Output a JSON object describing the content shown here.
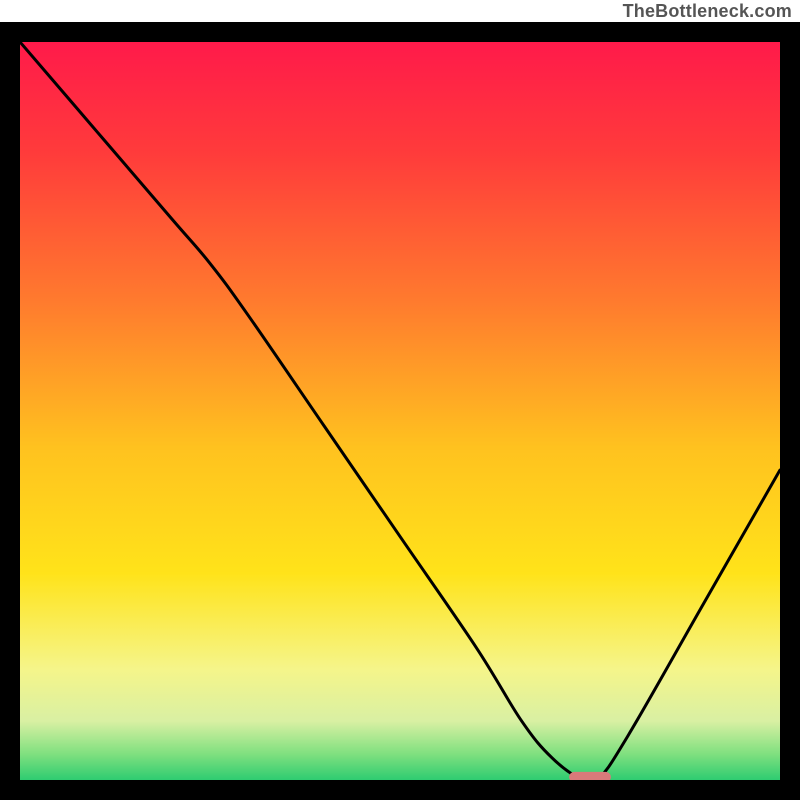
{
  "watermark": "TheBottleneck.com",
  "chart_data": {
    "type": "line",
    "title": "",
    "xlabel": "",
    "ylabel": "",
    "xlim": [
      0,
      100
    ],
    "ylim": [
      0,
      100
    ],
    "series": [
      {
        "name": "bottleneck-curve",
        "x": [
          0,
          10,
          20,
          25,
          30,
          40,
          50,
          60,
          66,
          70,
          74,
          76,
          80,
          90,
          100
        ],
        "y": [
          100,
          88,
          76,
          70,
          63,
          48,
          33,
          18,
          8,
          3,
          0,
          0,
          6,
          24,
          42
        ]
      }
    ],
    "marker": {
      "x": 75,
      "y": 0,
      "width": 5.5,
      "height": 1.4,
      "color": "#d97a7a"
    },
    "gradient_stops": [
      {
        "offset": 0.0,
        "color": "#ff1a4a"
      },
      {
        "offset": 0.15,
        "color": "#ff3b3b"
      },
      {
        "offset": 0.35,
        "color": "#ff7a2e"
      },
      {
        "offset": 0.55,
        "color": "#ffc21f"
      },
      {
        "offset": 0.72,
        "color": "#ffe31a"
      },
      {
        "offset": 0.85,
        "color": "#f5f58a"
      },
      {
        "offset": 0.92,
        "color": "#d9f0a3"
      },
      {
        "offset": 0.965,
        "color": "#7fe07f"
      },
      {
        "offset": 1.0,
        "color": "#2ecc71"
      }
    ],
    "border_px": 20
  }
}
